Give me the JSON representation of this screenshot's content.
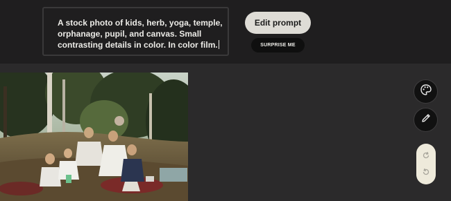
{
  "prompt": {
    "text": "A stock photo of  kids, herb, yoga, temple, orphanage, pupil, and canvas. Small contrasting details in color. In color film."
  },
  "buttons": {
    "edit_prompt": "Edit prompt",
    "surprise_me": "SURPRISE ME"
  },
  "tools": {
    "palette_icon": "palette-icon",
    "pencil_icon": "pencil-icon",
    "redo_icon": "redo-icon",
    "undo_icon": "undo-icon"
  },
  "colors": {
    "background": "#2b2a2b",
    "topbar": "#1f1e1f",
    "button_light": "#dedcd6",
    "button_dark": "#0f0f0f",
    "history_pill": "#eeeadb"
  }
}
